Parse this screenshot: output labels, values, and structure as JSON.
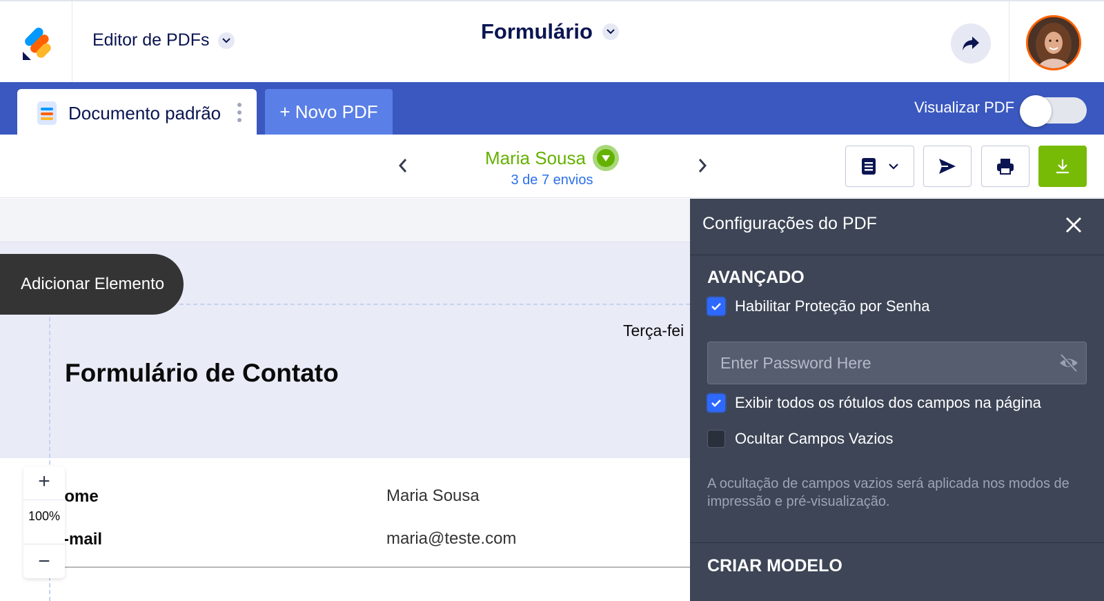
{
  "header": {
    "app_switch_label": "Editor de PDFs",
    "form_title": "Formulário"
  },
  "tabs": {
    "document_tab": "Documento padrão",
    "new_pdf": "+ Novo PDF",
    "preview_label": "Visualizar PDF",
    "preview_enabled": false
  },
  "submission": {
    "name": "Maria Sousa",
    "count": "3 de 7 envios"
  },
  "canvas": {
    "add_element": "Adicionar Elemento",
    "date_partial": "Terça-fei",
    "title": "Formulário de Contato",
    "fields": [
      {
        "label": "Nome",
        "value": "Maria Sousa"
      },
      {
        "label": "E-mail",
        "value": "maria@teste.com"
      }
    ],
    "zoom": "100%"
  },
  "panel": {
    "title": "Configurações do PDF",
    "advanced_title": "AVANÇADO",
    "password_protection": {
      "label": "Habilitar Proteção por Senha",
      "checked": true
    },
    "password_placeholder": "Enter Password Here",
    "show_labels": {
      "label": "Exibir todos os rótulos dos campos na página",
      "checked": true
    },
    "hide_empty": {
      "label": "Ocultar Campos Vazios",
      "checked": false
    },
    "note": "A ocultação de campos vazios será aplicada nos modos de impressão e pré-visualização.",
    "template_title": "CRIAR MODELO"
  },
  "colors": {
    "brand_blue": "#3a58bf",
    "new_pdf_tab": "#5a7fe6",
    "submission_green": "#64b200",
    "download_green": "#78bb07",
    "panel_bg": "#3d4556",
    "checkbox_on": "#2e69ff",
    "avatar_ring": "#ff6100"
  }
}
